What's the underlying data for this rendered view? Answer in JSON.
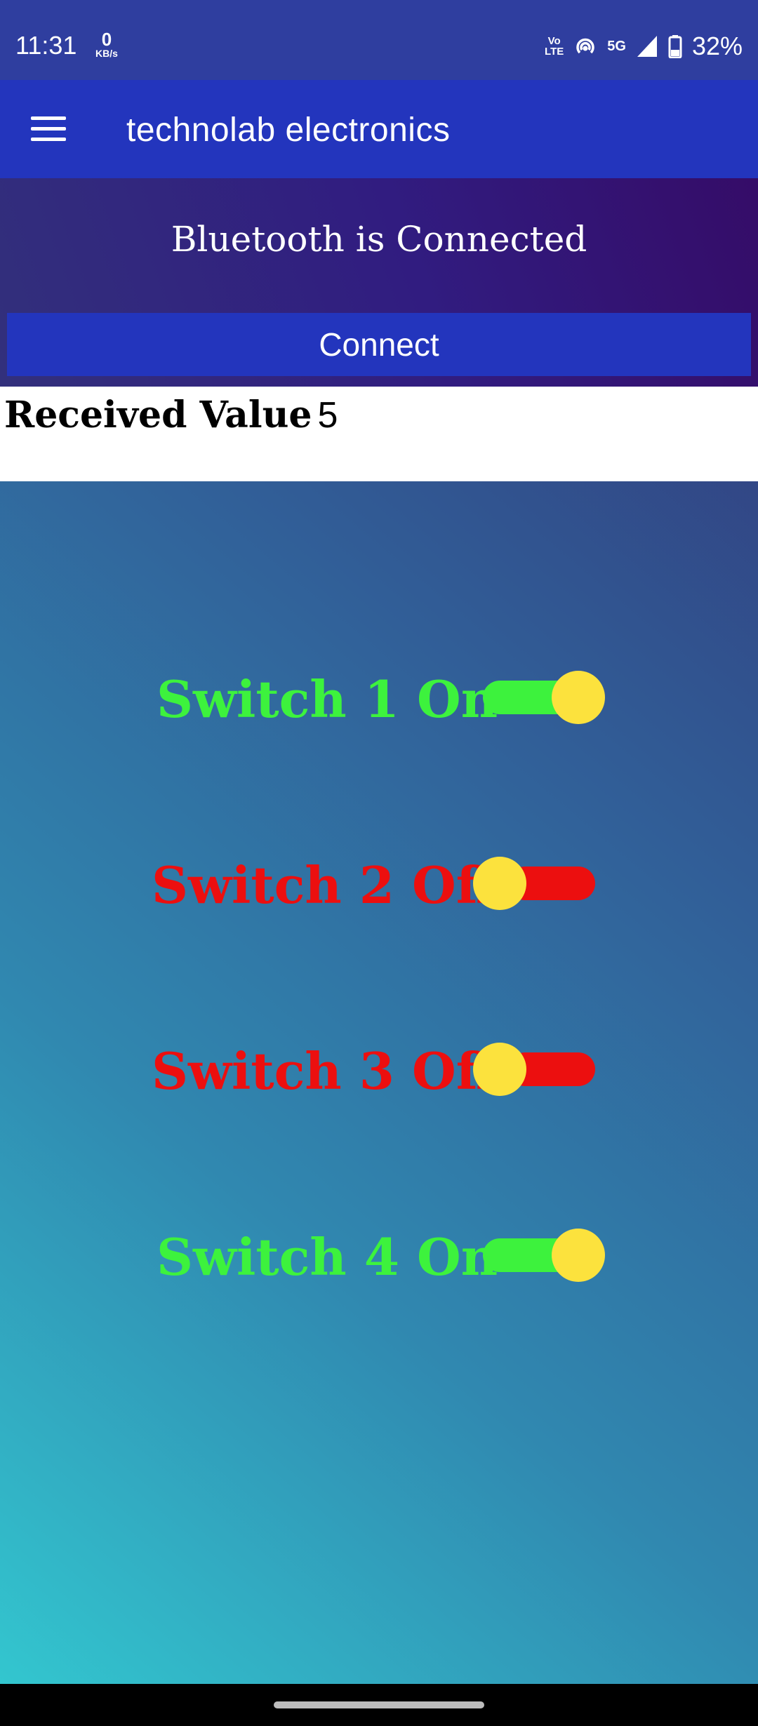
{
  "status_bar": {
    "time": "11:31",
    "net_speed_value": "0",
    "net_speed_unit": "KB/s",
    "volte_top": "Vo",
    "volte_bottom": "LTE",
    "network_type": "5G",
    "battery": "32%"
  },
  "app_bar": {
    "title": "technolab electronics",
    "menu_icon": "hamburger-menu-icon"
  },
  "bluetooth": {
    "status": "Bluetooth is Connected",
    "connect_label": "Connect"
  },
  "received": {
    "label": "Received Value",
    "value": "5"
  },
  "switches": [
    {
      "label": "Switch 1 On",
      "on": true
    },
    {
      "label": "Switch 2 Off",
      "on": false
    },
    {
      "label": "Switch 3 Off",
      "on": false
    },
    {
      "label": "Switch 4 On",
      "on": true
    }
  ],
  "colors": {
    "app_bar": "#2335bd",
    "on": "#3df23d",
    "off": "#ec0f0f",
    "thumb": "#fce23d"
  }
}
